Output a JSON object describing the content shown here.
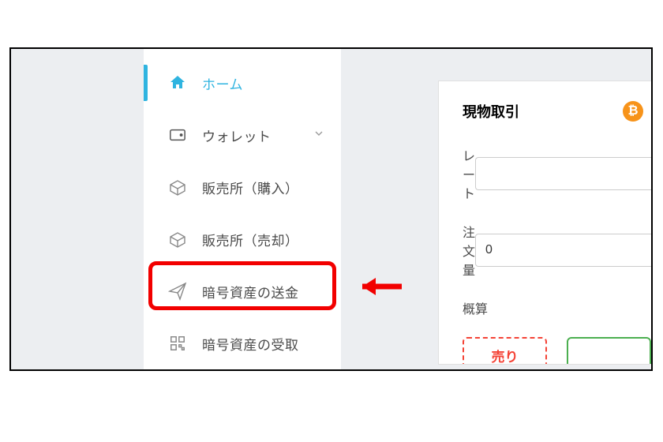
{
  "sidebar": {
    "items": [
      {
        "label": "ホーム",
        "icon": "home-icon",
        "active": true
      },
      {
        "label": "ウォレット",
        "icon": "wallet-icon",
        "expandable": true
      },
      {
        "label": "販売所（購入）",
        "icon": "box-up-icon"
      },
      {
        "label": "販売所（売却）",
        "icon": "box-down-icon"
      },
      {
        "label": "暗号資産の送金",
        "icon": "paper-plane-icon",
        "highlighted": true
      },
      {
        "label": "暗号資産の受取",
        "icon": "qr-code-icon"
      }
    ]
  },
  "trade": {
    "title": "現物取引",
    "currency_icon": "bitcoin-icon",
    "rows": {
      "rate": {
        "label": "レート",
        "value": ""
      },
      "qty": {
        "label": "注文量",
        "value": "0"
      },
      "est": {
        "label": "概算",
        "value": ""
      }
    },
    "sell_label": "売り",
    "buy_label": ""
  }
}
